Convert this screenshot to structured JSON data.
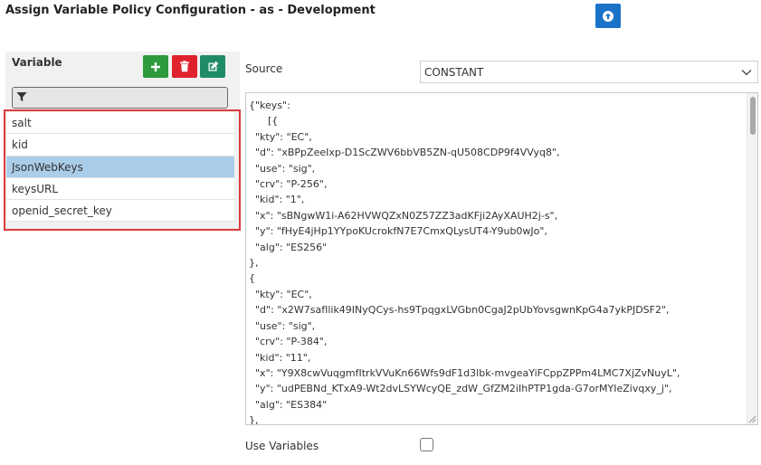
{
  "header": {
    "title": "Assign Variable Policy Configuration - as - Development",
    "upload_icon": "arrow-up-circle-icon",
    "accent_color": "#1a73c9"
  },
  "variable_panel": {
    "heading": "Variable",
    "buttons": {
      "add_icon": "plus-icon",
      "delete_icon": "trash-icon",
      "edit_icon": "edit-icon",
      "add_color": "#2e9a3d",
      "delete_color": "#e0222f",
      "edit_color": "#1f8c68"
    },
    "filter": {
      "icon": "filter-icon",
      "value": ""
    },
    "items": [
      {
        "label": "salt"
      },
      {
        "label": "kid"
      },
      {
        "label": "JsonWebKeys",
        "selected": true
      },
      {
        "label": "keysURL"
      },
      {
        "label": "openid_secret_key"
      }
    ],
    "highlight_color": "#dd3b3b",
    "selected_color": "#aacde9"
  },
  "form": {
    "source_label": "Source",
    "source_value": "CONSTANT",
    "code_text": "{\"keys\":\n      [{\n  \"kty\": \"EC\",\n  \"d\": \"xBPpZeeIxp-D1ScZWV6bbVB5ZN-qU508CDP9f4VVyq8\",\n  \"use\": \"sig\",\n  \"crv\": \"P-256\",\n  \"kid\": \"1\",\n  \"x\": \"sBNgwW1i-A62HVWQZxN0Z57ZZ3adKFji2AyXAUH2j-s\",\n  \"y\": \"fHyE4jHp1YYpoKUcrokfN7E7CmxQLysUT4-Y9ub0wJo\",\n  \"alg\": \"ES256\"\n},\n{\n  \"kty\": \"EC\",\n  \"d\": \"x2W7safIlik49INyQCys-hs9TpqgxLVGbn0CgaJ2pUbYovsgwnKpG4a7ykPJDSF2\",\n  \"use\": \"sig\",\n  \"crv\": \"P-384\",\n  \"kid\": \"11\",\n  \"x\": \"Y9X8cwVuqgmfItrkVVuKn66Wfs9dF1d3lbk-mvgeaYiFCppZPPm4LMC7XjZvNuyL\",\n  \"y\": \"udPEBNd_KTxA9-Wt2dvLSYWcyQE_zdW_GfZM2iIhPTP1gda-G7orMYIeZivqxy_j\",\n  \"alg\": \"ES384\"\n},",
    "use_variables_label": "Use Variables",
    "use_variables_checked": false
  }
}
